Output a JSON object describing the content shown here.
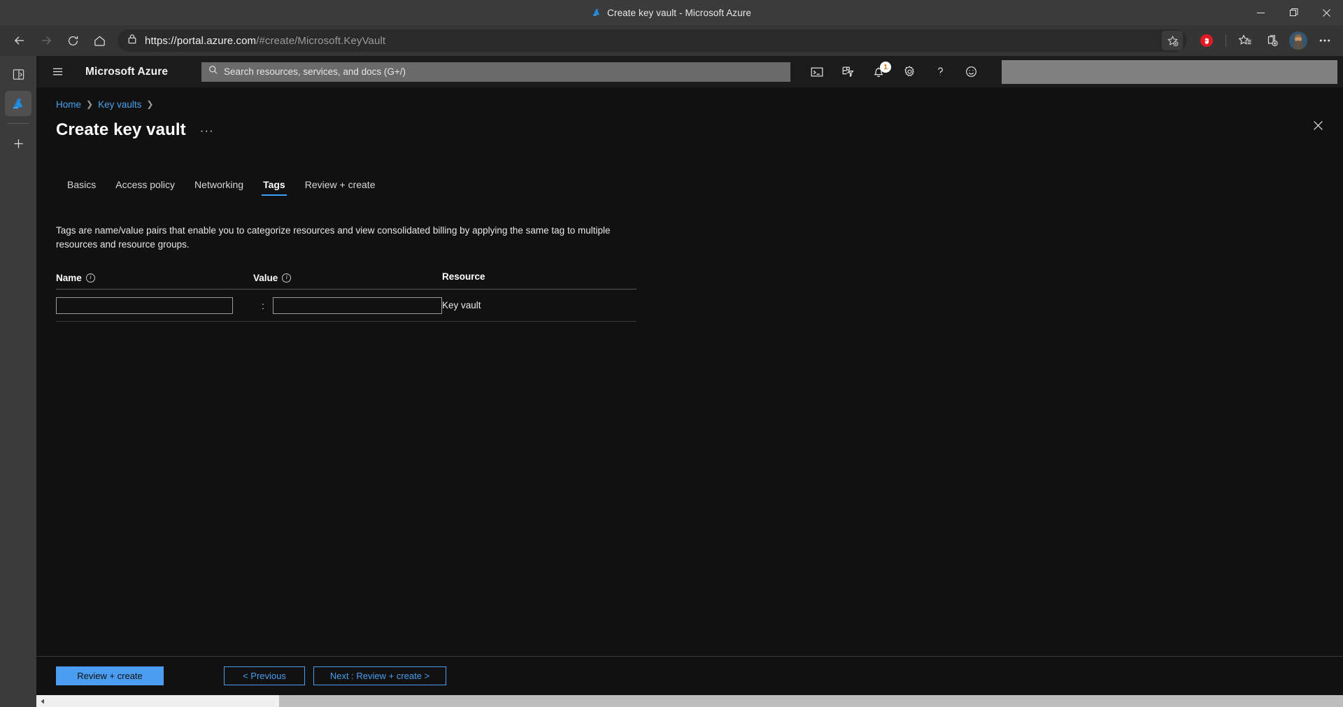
{
  "browser": {
    "window_title": "Create key vault - Microsoft Azure",
    "url_main": "https://portal.azure.com",
    "url_path": "/#create/Microsoft.KeyVault",
    "controls": {
      "minimize": "minimize",
      "maximize": "maximize",
      "close": "close"
    },
    "nav": {
      "back": "Back",
      "forward": "Forward",
      "refresh": "Refresh",
      "home": "Home"
    },
    "toolbar_right": {
      "favorite": "Add this page to favorites",
      "extension": "Extension",
      "favorites": "Favorites",
      "collections": "Collections",
      "profile": "Profile",
      "settings": "Settings and more"
    },
    "sidebar": {
      "split_screen": "Split screen",
      "azure_tab": "Microsoft Azure",
      "add": "Add"
    }
  },
  "azure": {
    "brand": "Microsoft Azure",
    "hamburger": "Show portal menu",
    "search": {
      "placeholder": "Search resources, services, and docs (G+/)",
      "value": ""
    },
    "header_icons": {
      "cloud_shell": "Cloud Shell",
      "directories": "Directories + subscriptions",
      "notifications": "Notifications",
      "notifications_count": "1",
      "settings": "Settings",
      "help": "Help",
      "feedback": "Feedback"
    },
    "breadcrumb": [
      {
        "label": "Home"
      },
      {
        "label": "Key vaults"
      }
    ],
    "page_title": "Create key vault",
    "page_menu": "···",
    "close": "Close",
    "tabs": [
      {
        "label": "Basics",
        "active": false
      },
      {
        "label": "Access policy",
        "active": false
      },
      {
        "label": "Networking",
        "active": false
      },
      {
        "label": "Tags",
        "active": true
      },
      {
        "label": "Review + create",
        "active": false
      }
    ],
    "tags": {
      "description": "Tags are name/value pairs that enable you to categorize resources and view consolidated billing by applying the same tag to multiple resources and resource groups.",
      "columns": {
        "name": "Name",
        "value": "Value",
        "resource": "Resource"
      },
      "separator": ":",
      "rows": [
        {
          "name_value": "",
          "value_value": "",
          "resource": "Key vault"
        }
      ]
    },
    "footer": {
      "review_create": "Review + create",
      "previous": "< Previous",
      "next": "Next : Review + create >"
    },
    "colors": {
      "accent": "#4a9df0",
      "link": "#4aa3f0",
      "tab_underline": "#3aa0f3",
      "badge_text": "#d87b00",
      "blade_bg": "#111111",
      "header_bg": "#1b1b1b"
    }
  }
}
